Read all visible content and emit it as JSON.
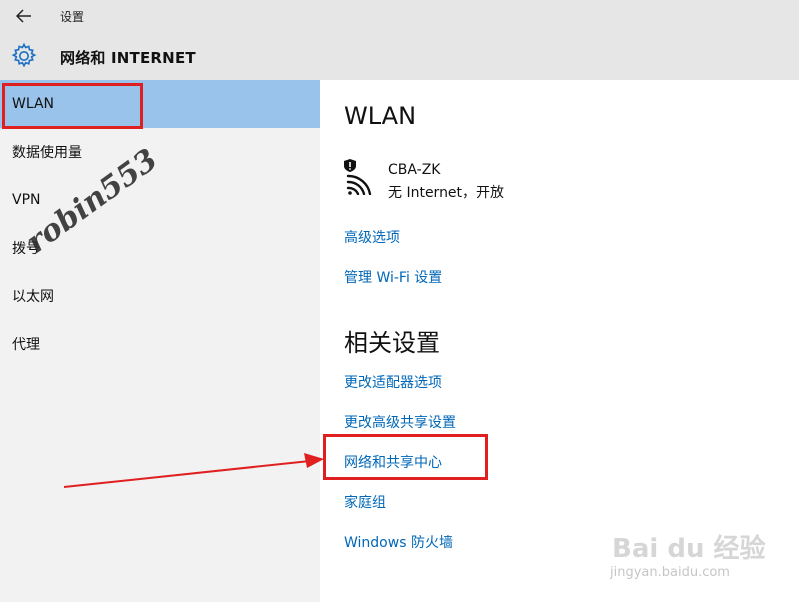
{
  "window": {
    "title": "设置"
  },
  "header": {
    "section_title": "网络和 INTERNET"
  },
  "sidebar": {
    "items": [
      {
        "label": "WLAN",
        "selected": true
      },
      {
        "label": "数据使用量"
      },
      {
        "label": "VPN"
      },
      {
        "label": "拨号"
      },
      {
        "label": "以太网"
      },
      {
        "label": "代理"
      }
    ]
  },
  "main": {
    "heading": "WLAN",
    "network": {
      "name": "CBA-ZK",
      "status": "无 Internet，开放"
    },
    "links": [
      "高级选项",
      "管理 Wi-Fi 设置"
    ],
    "related_heading": "相关设置",
    "related_links": [
      "更改适配器选项",
      "更改高级共享设置",
      "网络和共享中心",
      "家庭组",
      "Windows 防火墙"
    ]
  },
  "annotations": {
    "watermark_user": "robin553",
    "baidu_logo": "Bai du 经验",
    "baidu_url": "jingyan.baidu.com"
  },
  "colors": {
    "selected_bg": "#99c3ea",
    "link": "#0067b8",
    "highlight_box": "#e02020"
  }
}
